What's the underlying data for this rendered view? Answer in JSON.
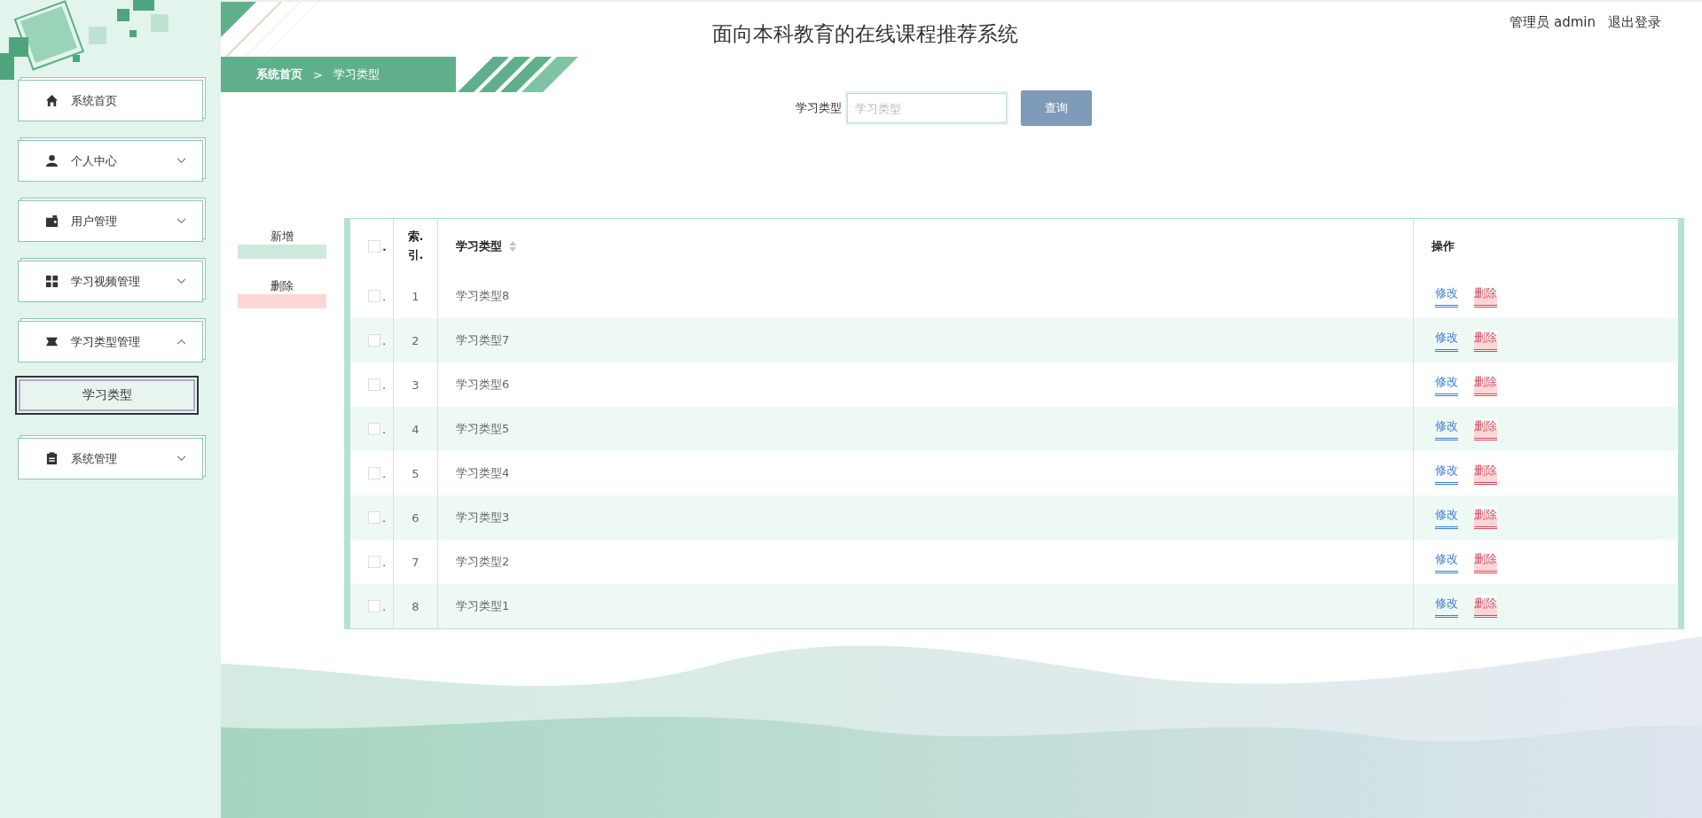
{
  "header": {
    "title": "面向本科教育的在线课程推荐系统",
    "user": "管理员 admin",
    "logout": "退出登录"
  },
  "sidebar": {
    "items": [
      {
        "label": "系统首页",
        "kind": "link"
      },
      {
        "label": "个人中心",
        "kind": "group",
        "expanded": false
      },
      {
        "label": "用户管理",
        "kind": "group",
        "expanded": false
      },
      {
        "label": "学习视频管理",
        "kind": "group",
        "expanded": false
      },
      {
        "label": "学习类型管理",
        "kind": "group",
        "expanded": true,
        "children": [
          {
            "label": "学习类型",
            "selected": true
          }
        ]
      },
      {
        "label": "系统管理",
        "kind": "group",
        "expanded": false
      }
    ]
  },
  "breadcrumb": [
    "系统首页",
    "学习类型"
  ],
  "breadcrumb_separator": ">",
  "search": {
    "label": "学习类型",
    "placeholder": "学习类型",
    "button": "查询"
  },
  "actions": [
    "新增",
    "删除"
  ],
  "table": {
    "all_checked": false,
    "columns": [
      ".",
      "索.引.",
      "学习类型",
      "操作"
    ],
    "rows": [
      {
        "checked": false,
        "check_label": ".",
        "index": "1",
        "type": "学习类型8",
        "edit": "修改",
        "delete": "删除"
      },
      {
        "checked": false,
        "check_label": ".",
        "index": "2",
        "type": "学习类型7",
        "edit": "修改",
        "delete": "删除"
      },
      {
        "checked": false,
        "check_label": ".",
        "index": "3",
        "type": "学习类型6",
        "edit": "修改",
        "delete": "删除"
      },
      {
        "checked": false,
        "check_label": ".",
        "index": "4",
        "type": "学习类型5",
        "edit": "修改",
        "delete": "删除"
      },
      {
        "checked": false,
        "check_label": ".",
        "index": "5",
        "type": "学习类型4",
        "edit": "修改",
        "delete": "删除"
      },
      {
        "checked": false,
        "check_label": ".",
        "index": "6",
        "type": "学习类型3",
        "edit": "修改",
        "delete": "删除"
      },
      {
        "checked": false,
        "check_label": ".",
        "index": "7",
        "type": "学习类型2",
        "edit": "修改",
        "delete": "删除"
      },
      {
        "checked": false,
        "check_label": ".",
        "index": "8",
        "type": "学习类型1",
        "edit": "修改",
        "delete": "删除"
      }
    ]
  }
}
